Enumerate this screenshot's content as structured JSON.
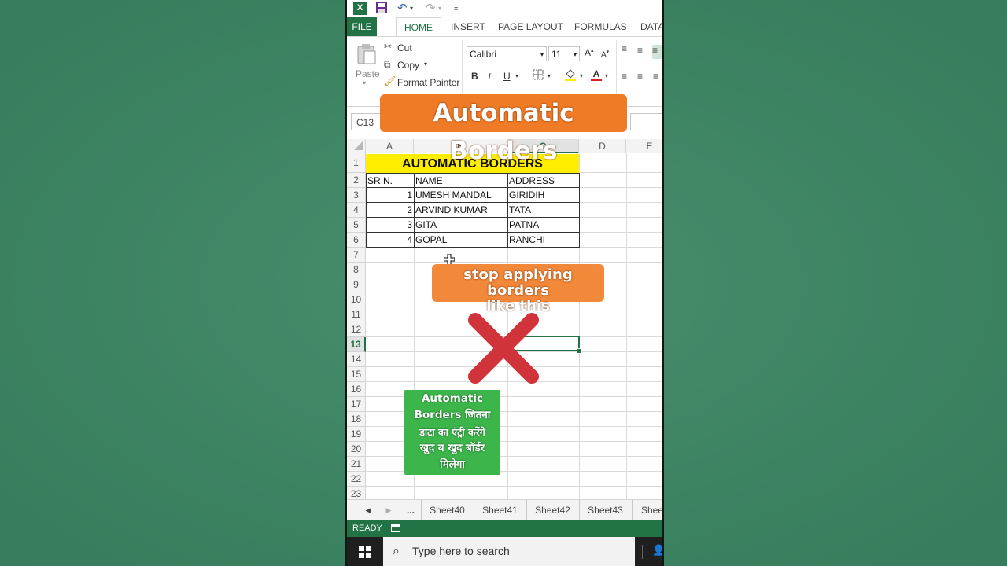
{
  "excel": {
    "tabs": [
      "FILE",
      "HOME",
      "INSERT",
      "PAGE LAYOUT",
      "FORMULAS",
      "DATA"
    ],
    "clipboard": {
      "paste": "Paste",
      "cut": "Cut",
      "copy": "Copy",
      "format_painter": "Format Painter"
    },
    "font": {
      "name": "Calibri",
      "size": "11"
    },
    "name_box": "C13",
    "columns": [
      "A",
      "B",
      "C",
      "D",
      "E"
    ],
    "rows": [
      "1",
      "2",
      "3",
      "4",
      "5",
      "6",
      "7",
      "8",
      "9",
      "10",
      "11",
      "12",
      "13",
      "14",
      "15",
      "16",
      "17",
      "18",
      "19",
      "20",
      "21",
      "22",
      "23"
    ],
    "sheet_title": "AUTOMATIC BORDERS",
    "headers": [
      "SR N.",
      "NAME",
      "ADDRESS"
    ],
    "table_rows": [
      {
        "sr": "1",
        "name": "UMESH MANDAL",
        "address": "GIRIDIH"
      },
      {
        "sr": "2",
        "name": "ARVIND KUMAR",
        "address": "TATA"
      },
      {
        "sr": "3",
        "name": "GITA",
        "address": "PATNA"
      },
      {
        "sr": "4",
        "name": "GOPAL",
        "address": "RANCHI"
      }
    ],
    "sheet_tabs": [
      "...",
      "Sheet40",
      "Sheet41",
      "Sheet42",
      "Sheet43",
      "Shee"
    ],
    "status": "READY",
    "taskbar_search": "Type here to search",
    "accent": "#217346"
  },
  "overlays": {
    "title": "Automatic Borders",
    "stop_line1": "stop applying borders",
    "stop_line2": "like this",
    "hindi_lines": [
      "Automatic",
      "Borders जितना",
      "डाटा का एंट्री करेंगे",
      "खुद ब खुद बॉर्डर",
      "मिलेगा"
    ],
    "title_color": "#f07b26",
    "hindi_color": "#3cb54a",
    "x_color": "#d0333a"
  }
}
